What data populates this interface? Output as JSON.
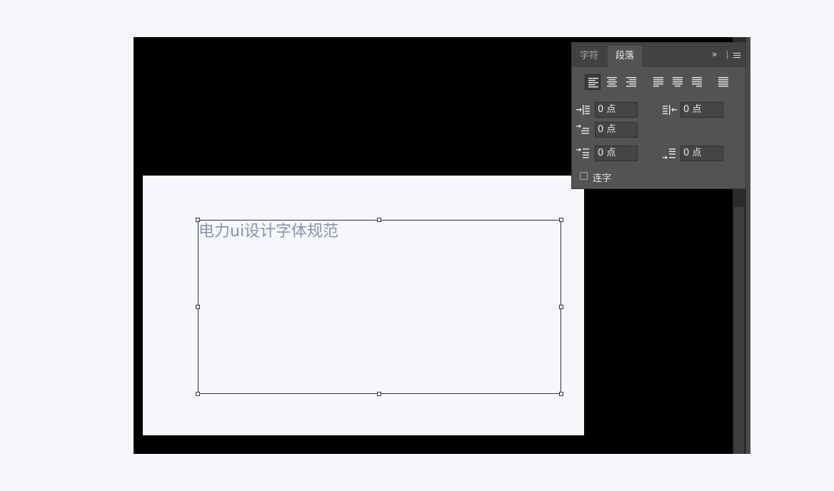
{
  "canvas": {
    "text": "电力ui设计字体规范"
  },
  "panel": {
    "tabs": [
      {
        "label": "字符",
        "active": false
      },
      {
        "label": "段落",
        "active": true
      }
    ],
    "collapse_label": "»",
    "alignment_buttons": [
      {
        "name": "align-left",
        "active": true
      },
      {
        "name": "align-center",
        "active": false
      },
      {
        "name": "align-right",
        "active": false
      },
      {
        "name": "justify-last-left",
        "active": false
      },
      {
        "name": "justify-last-center",
        "active": false
      },
      {
        "name": "justify-last-right",
        "active": false
      },
      {
        "name": "justify-all",
        "active": false
      }
    ],
    "fields": {
      "left_indent": "0 点",
      "right_indent": "0 点",
      "first_line_indent": "0 点",
      "space_before": "0 点",
      "space_after": "0 点"
    },
    "hyphenate_label": "连字",
    "hyphenate_checked": false
  },
  "colors": {
    "workspace": "#000000",
    "artboard": "#f6f7fb",
    "panel": "#535353",
    "canvas_text": "#8b93ad"
  }
}
